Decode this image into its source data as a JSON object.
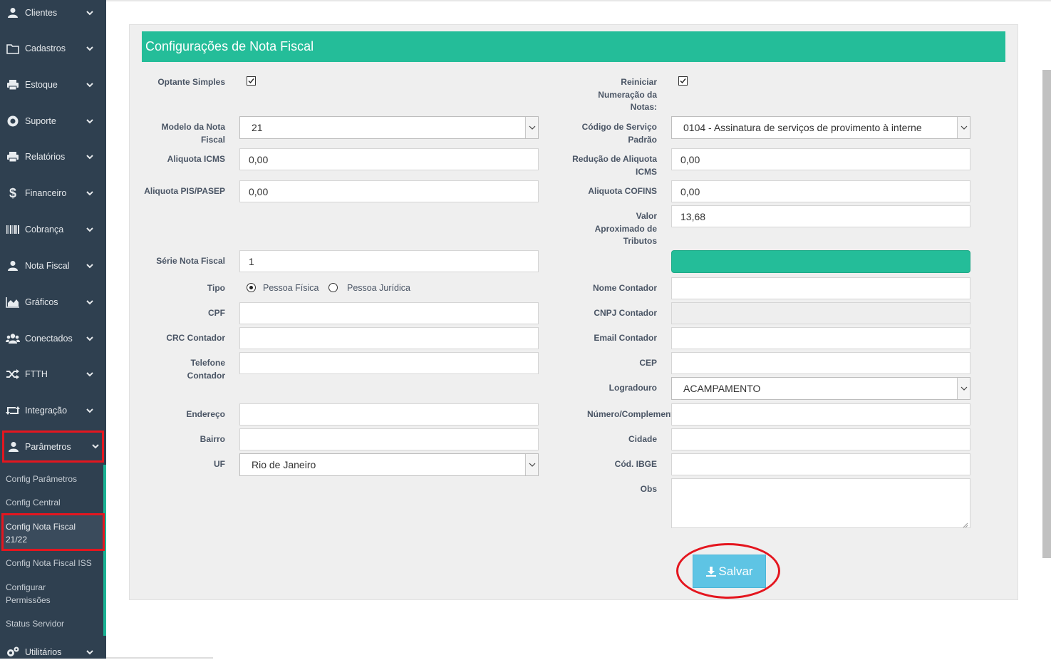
{
  "sidebar": {
    "items": [
      {
        "label": "Clientes",
        "icon": "user-icon"
      },
      {
        "label": "Cadastros",
        "icon": "folder-icon"
      },
      {
        "label": "Estoque",
        "icon": "print-icon"
      },
      {
        "label": "Suporte",
        "icon": "life-ring-icon"
      },
      {
        "label": "Relatórios",
        "icon": "print-icon"
      },
      {
        "label": "Financeiro",
        "icon": "dollar-icon"
      },
      {
        "label": "Cobrança",
        "icon": "barcode-icon"
      },
      {
        "label": "Nota Fiscal",
        "icon": "user-icon"
      },
      {
        "label": "Gráficos",
        "icon": "area-chart-icon"
      },
      {
        "label": "Conectados",
        "icon": "users-icon"
      },
      {
        "label": "FTTH",
        "icon": "random-icon"
      },
      {
        "label": "Integração",
        "icon": "retweet-icon"
      },
      {
        "label": "Parâmetros",
        "icon": "user-icon"
      },
      {
        "label": "Utilitários",
        "icon": "cogs-icon"
      }
    ],
    "submenu": [
      "Config Parâmetros",
      "Config Central",
      "Config Nota Fiscal 21/22",
      "Config Nota Fiscal ISS",
      "Configurar Permissões",
      "Status Servidor"
    ]
  },
  "panel": {
    "title": "Configurações de Nota Fiscal"
  },
  "form": {
    "optante_simples": {
      "label": "Optante Simples",
      "checked": true
    },
    "reiniciar": {
      "label": "Reiniciar Numeração da Notas:",
      "checked": true
    },
    "modelo": {
      "label": "Modelo da Nota Fiscal",
      "value": "21"
    },
    "codigo_servico": {
      "label": "Código de Serviço Padrão",
      "value": "0104 - Assinatura de serviços de provimento à interne"
    },
    "aliquota_icms": {
      "label": "Aliquota ICMS",
      "value": "0,00"
    },
    "reducao_icms": {
      "label": "Redução de Aliquota ICMS",
      "value": "0,00"
    },
    "aliquota_pis": {
      "label": "Aliquota PIS/PASEP",
      "value": "0,00"
    },
    "aliquota_cofins": {
      "label": "Aliquota COFINS",
      "value": "0,00"
    },
    "valor_tributos": {
      "label": "Valor Aproximado de Tributos",
      "value": "13,68"
    },
    "serie": {
      "label": "Série Nota Fiscal",
      "value": "1"
    },
    "tipo": {
      "label": "Tipo",
      "opt1": "Pessoa Física",
      "opt2": "Pessoa Jurídica",
      "selected": "Pessoa Física"
    },
    "nome_contador": {
      "label": "Nome Contador",
      "value": ""
    },
    "cpf": {
      "label": "CPF",
      "value": ""
    },
    "cnpj_contador": {
      "label": "CNPJ Contador",
      "value": ""
    },
    "crc": {
      "label": "CRC Contador",
      "value": ""
    },
    "email_contador": {
      "label": "Email Contador",
      "value": ""
    },
    "telefone": {
      "label": "Telefone Contador",
      "value": ""
    },
    "cep": {
      "label": "CEP",
      "value": ""
    },
    "logradouro": {
      "label": "Logradouro",
      "value": "ACAMPAMENTO"
    },
    "endereco": {
      "label": "Endereço",
      "value": ""
    },
    "numero": {
      "label": "Número/Complemento",
      "value": ""
    },
    "bairro": {
      "label": "Bairro",
      "value": ""
    },
    "cidade": {
      "label": "Cidade",
      "value": ""
    },
    "uf": {
      "label": "UF",
      "value": "Rio de Janeiro"
    },
    "ibge": {
      "label": "Cód. IBGE",
      "value": ""
    },
    "obs": {
      "label": "Obs",
      "value": ""
    }
  },
  "actions": {
    "save_label": "Salvar"
  },
  "colors": {
    "sidebar_bg": "#2f4050",
    "accent": "#24bd99",
    "save_button": "#5ec4e4",
    "highlight": "#e4161f"
  }
}
